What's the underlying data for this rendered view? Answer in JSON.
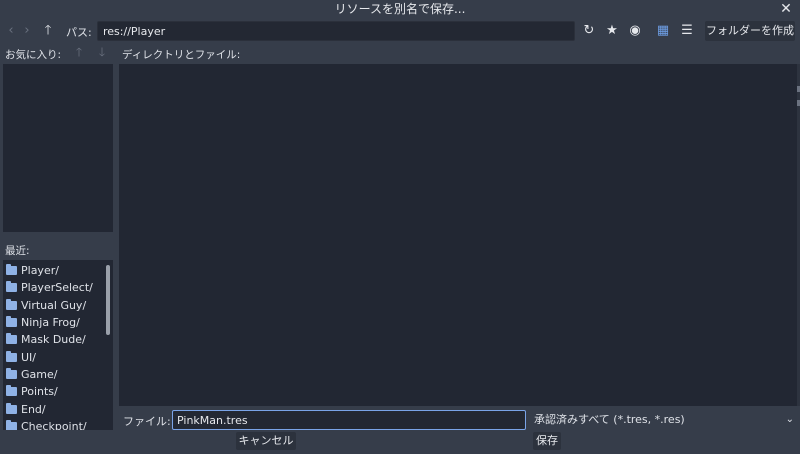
{
  "window": {
    "title": "リソースを別名で保存..."
  },
  "toolbar": {
    "path_label": "パス:",
    "path_value": "res://Player",
    "create_folder_label": "フォルダーを作成"
  },
  "favorites": {
    "label": "お気に入り:"
  },
  "directories": {
    "label": "ディレクトリとファイル:"
  },
  "recent": {
    "label": "最近:",
    "items": [
      "Player/",
      "PlayerSelect/",
      "Virtual Guy/",
      "Ninja Frog/",
      "Mask Dude/",
      "UI/",
      "Game/",
      "Points/",
      "End/",
      "Checkpoint/"
    ]
  },
  "footer": {
    "file_label": "ファイル:",
    "filename_value": "PinkMan.tres",
    "filter_value": "承認済みすべて (*.tres, *.res)",
    "cancel_label": "キャンセル",
    "save_label": "保存"
  },
  "colors": {
    "background": "#363d4a",
    "panel": "#222733",
    "accent": "#6fa0e8",
    "folder": "#8fb2e6"
  },
  "icons": {
    "back": "chevron-left-icon",
    "forward": "chevron-right-icon",
    "up": "arrow-up-icon",
    "refresh": "refresh-icon",
    "favorite": "star-icon",
    "hidden": "eye-icon",
    "grid": "grid-view-icon",
    "list": "list-view-icon",
    "close": "close-icon"
  }
}
